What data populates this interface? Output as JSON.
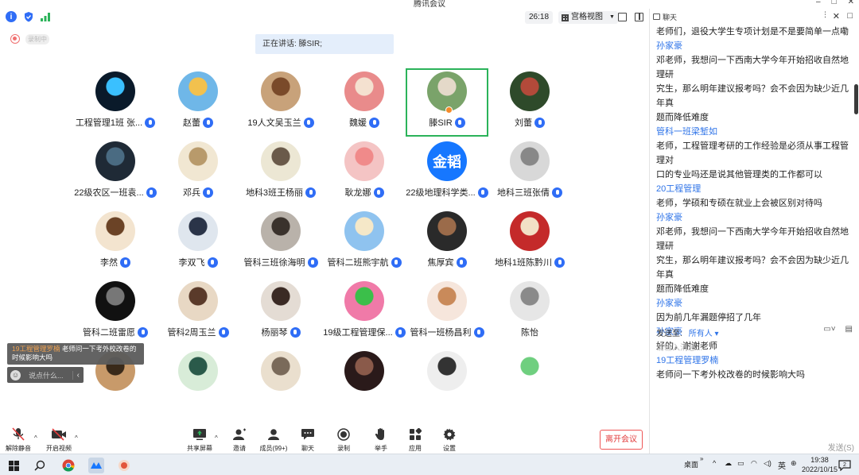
{
  "window": {
    "title": "腾讯会议"
  },
  "toolbar": {
    "timer": "26:18",
    "view_label": "宫格视图"
  },
  "recording": {
    "label": "录制中"
  },
  "speaking": {
    "text": "正在讲话: 滕SIR;"
  },
  "participants": [
    {
      "name": "工程管理1班 张...",
      "mic": true,
      "color": "#0a1a2a",
      "accent": "#3ac0ff"
    },
    {
      "name": "赵蕾",
      "mic": true,
      "color": "#6fb7e8",
      "accent": "#f2c14e"
    },
    {
      "name": "19人文吴玉兰",
      "mic": true,
      "color": "#c8a27a",
      "accent": "#7a4a2a"
    },
    {
      "name": "魏媛",
      "mic": true,
      "color": "#e98b8b",
      "accent": "#f4e1d0"
    },
    {
      "name": "滕SIR",
      "mic": true,
      "color": "#7aa36a",
      "accent": "#e4d9c9",
      "active": true
    },
    {
      "name": "刘蕾",
      "mic": true,
      "color": "#2e4a2a",
      "accent": "#b24a3a"
    },
    {
      "name": "22级农区一班袁...",
      "mic": true,
      "color": "#1f2a36",
      "accent": "#4a6b82"
    },
    {
      "name": "邓兵",
      "mic": true,
      "color": "#f1e7d2",
      "accent": "#b89a6b"
    },
    {
      "name": "地科3班王杨丽",
      "mic": true,
      "color": "#ece7d4",
      "accent": "#6a5a4a"
    },
    {
      "name": "耿龙娜",
      "mic": true,
      "color": "#f4c4c4",
      "accent": "#f08a8a"
    },
    {
      "name": "22级地理科学类...",
      "mic": true,
      "color": "#1677ff",
      "accent": "#ffffff",
      "text": "金韬"
    },
    {
      "name": "地科三班张倩",
      "mic": true,
      "color": "#d8d8d8",
      "accent": "#888"
    },
    {
      "name": "李然",
      "mic": true,
      "color": "#f3e4cf",
      "accent": "#6b4326"
    },
    {
      "name": "李双飞",
      "mic": true,
      "color": "#dfe6ee",
      "accent": "#2a3448"
    },
    {
      "name": "管科三班徐海明",
      "mic": true,
      "color": "#b9b2aa",
      "accent": "#3a322c"
    },
    {
      "name": "管科二班熊宇航",
      "mic": true,
      "color": "#8fc3ef",
      "accent": "#f5e8c8"
    },
    {
      "name": "焦厚宾",
      "mic": true,
      "color": "#2a2a2a",
      "accent": "#9b6b4a"
    },
    {
      "name": "地科1班陈黔川",
      "mic": true,
      "color": "#c42a2a",
      "accent": "#f2e1c6"
    },
    {
      "name": "管科二班雷愿",
      "mic": true,
      "color": "#111111",
      "accent": "#777"
    },
    {
      "name": "管科2周玉兰",
      "mic": true,
      "color": "#e8d8c4",
      "accent": "#5a3a2a"
    },
    {
      "name": "杨丽琴",
      "mic": true,
      "color": "#e4dcd4",
      "accent": "#3a2a24"
    },
    {
      "name": "19级工程管理保...",
      "mic": true,
      "color": "#f07aa8",
      "accent": "#3bbf4a"
    },
    {
      "name": "管科一班杨昌利",
      "mic": true,
      "color": "#f6e6dc",
      "accent": "#c98a5a"
    },
    {
      "name": "陈怡",
      "mic": false,
      "color": "#e6e6e6",
      "accent": "#8a8a8a"
    },
    {
      "name": "",
      "mic": false,
      "color": "#c89a6a",
      "accent": "#3a2a1a"
    },
    {
      "name": "",
      "mic": false,
      "color": "#d8ecd8",
      "accent": "#2a5a4a"
    },
    {
      "name": "",
      "mic": false,
      "color": "#eadfce",
      "accent": "#7a6a5a"
    },
    {
      "name": "",
      "mic": false,
      "color": "#2a1a1a",
      "accent": "#8a5a4a"
    },
    {
      "name": "",
      "mic": false,
      "color": "#eeeeee",
      "accent": "#333"
    },
    {
      "name": "",
      "mic": false,
      "color": "#ffffff",
      "accent": "#6fcf7f"
    }
  ],
  "notification": {
    "sender": "19工程管理罗楠",
    "text": "老师问一下考外校改卷的时候影响大吗"
  },
  "quick_message": {
    "placeholder": "说点什么..."
  },
  "bottom_bar": {
    "mute": "解除静音",
    "video": "开启视频",
    "share": "共享屏幕",
    "invite": "邀请",
    "members": "成员(99+)",
    "chat": "聊天",
    "record": "录制",
    "raise_hand": "举手",
    "apps": "应用",
    "settings": "设置",
    "leave": "离开会议"
  },
  "chat": {
    "title": "聊天",
    "messages": [
      {
        "type": "text",
        "value": "老师们，退役大学生专项计划是不是要简单一点嘞"
      },
      {
        "type": "sender",
        "value": "孙家豪"
      },
      {
        "type": "text",
        "value": "邓老师，我想问一下西南大学今年开始招收自然地理研"
      },
      {
        "type": "text",
        "value": "究生，那么明年建议报考吗？会不会因为缺少近几年真"
      },
      {
        "type": "text",
        "value": "题而降低难度"
      },
      {
        "type": "sender",
        "value": "管科一班梁堑如"
      },
      {
        "type": "text",
        "value": "老师，工程管理考研的工作经验是必须从事工程管理对"
      },
      {
        "type": "text",
        "value": "口的专业吗还是说其他管理类的工作都可以"
      },
      {
        "type": "sender",
        "value": "20工程管理"
      },
      {
        "type": "text",
        "value": "老师，学硕和专硕在就业上会被区别对待吗"
      },
      {
        "type": "sender",
        "value": "孙家豪"
      },
      {
        "type": "text",
        "value": "邓老师，我想问一下西南大学今年开始招收自然地理研"
      },
      {
        "type": "text",
        "value": "究生，那么明年建议报考吗？会不会因为缺少近几年真"
      },
      {
        "type": "text",
        "value": "题而降低难度"
      },
      {
        "type": "sender",
        "value": "孙家豪"
      },
      {
        "type": "text",
        "value": "因为前几年漏题停招了几年"
      },
      {
        "type": "sender",
        "value": "孙家豪"
      },
      {
        "type": "text",
        "value": "好的，谢谢老师"
      },
      {
        "type": "sender",
        "value": "19工程管理罗楠"
      },
      {
        "type": "text",
        "value": "老师问一下考外校改卷的时候影响大吗"
      }
    ],
    "send_to_label": "发送至:",
    "send_to_target": "所有人 ▾",
    "input_placeholder": "请输入消息...",
    "send_button": "发送(S)"
  },
  "taskbar": {
    "desktop_label": "桌面",
    "ime": "英",
    "time": "19:38",
    "date": "2022/10/15",
    "notif_count": "2"
  }
}
